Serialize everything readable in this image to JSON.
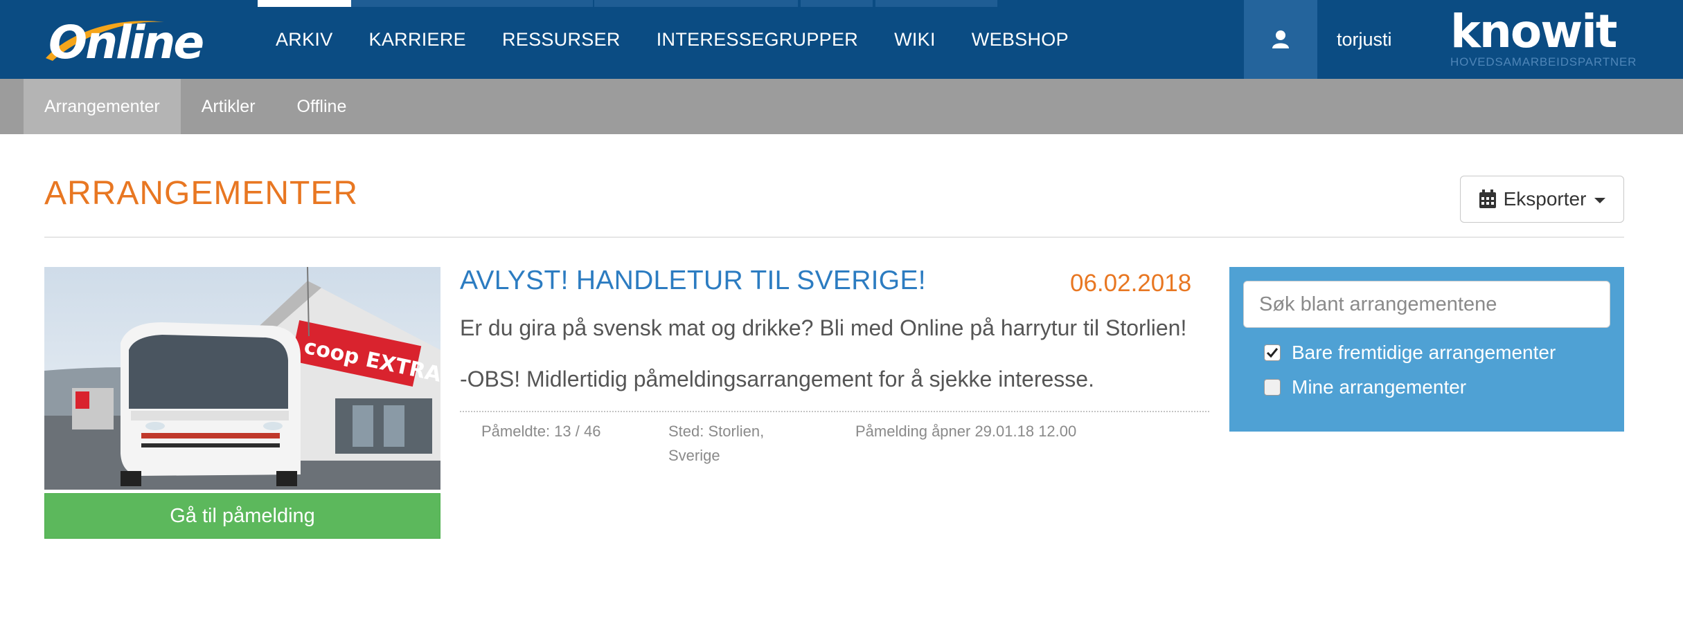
{
  "header": {
    "nav": [
      {
        "label": "ARKIV",
        "active": true
      },
      {
        "label": "KARRIERE",
        "active": false
      },
      {
        "label": "RESSURSER",
        "active": false
      },
      {
        "label": "INTERESSEGRUPPER",
        "active": false
      },
      {
        "label": "WIKI",
        "active": false
      },
      {
        "label": "WEBSHOP",
        "active": false
      }
    ],
    "user": {
      "icon": "user-icon",
      "name": "torjusti"
    },
    "partner": {
      "name": "knowit",
      "tagline": "HOVEDSAMARBEIDSPARTNER"
    },
    "logo_alt": "Online"
  },
  "subnav": [
    {
      "label": "Arrangementer",
      "active": true
    },
    {
      "label": "Artikler",
      "active": false
    },
    {
      "label": "Offline",
      "active": false
    }
  ],
  "page": {
    "title": "ARRANGEMENTER",
    "export_label": "Eksporter"
  },
  "event": {
    "title": "AVLYST! HANDLETUR TIL SVERIGE!",
    "date": "06.02.2018",
    "description": "Er du gira på svensk mat og drikke? Bli med Online på harrytur til Storlien!",
    "note": "-OBS! Midlertidig påmeldingsarrangement for å sjekke interesse.",
    "attendees": "Påmeldte: 13 / 46",
    "location_line1": "Sted: Storlien,",
    "location_line2": "Sverige",
    "registration": "Påmelding åpner 29.01.18 12.00",
    "signup_label": "Gå til påmelding",
    "image_sign": "coop EXTRA"
  },
  "filter": {
    "search_placeholder": "Søk blant arrangementene",
    "search_value": "",
    "options": [
      {
        "label": "Bare fremtidige arrangementer",
        "checked": true
      },
      {
        "label": "Mine arrangementer",
        "checked": false
      }
    ]
  },
  "colors": {
    "nav_bg": "#0b4c83",
    "accent_orange": "#e87722",
    "link_blue": "#2c7cc1",
    "panel_blue": "#4fa1d4",
    "button_green": "#5cb85c"
  }
}
